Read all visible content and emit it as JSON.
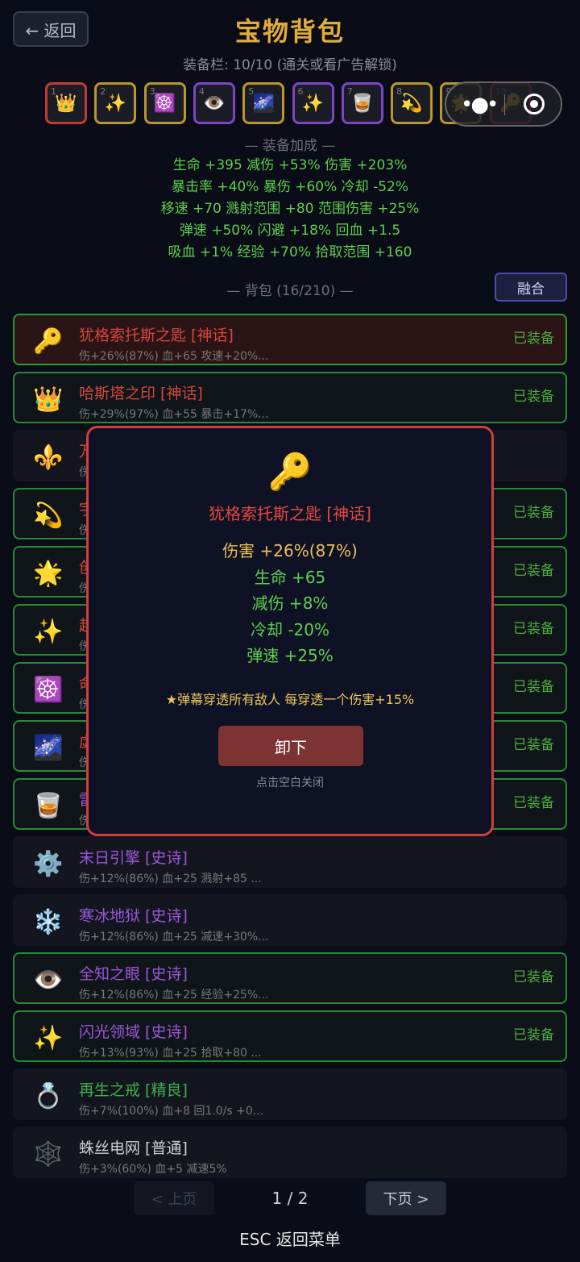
{
  "header": {
    "back_label": "← 返回",
    "title": "宝物背包",
    "slot_info": "装备栏: 10/10 (通关或看广告解锁)"
  },
  "slots": [
    {
      "num": "1",
      "icon": "👑",
      "color": "#c23a35"
    },
    {
      "num": "2",
      "icon": "✨",
      "color": "#b9962e"
    },
    {
      "num": "3",
      "icon": "☸️",
      "color": "#b9962e"
    },
    {
      "num": "4",
      "icon": "👁️",
      "color": "#7d45c4"
    },
    {
      "num": "5",
      "icon": "🌌",
      "color": "#b9962e"
    },
    {
      "num": "6",
      "icon": "✨",
      "color": "#7d45c4"
    },
    {
      "num": "7",
      "icon": "🥃",
      "color": "#7d45c4"
    },
    {
      "num": "8",
      "icon": "💫",
      "color": "#b9962e"
    },
    {
      "num": "9",
      "icon": "🌟",
      "color": "#b9962e"
    },
    {
      "num": "10",
      "icon": "🔑",
      "color": "#c23a35"
    }
  ],
  "bonus": {
    "title": "— 装备加成 —",
    "lines": [
      "生命 +395  减伤 +53%  伤害 +203%",
      "暴击率 +40%  暴伤 +60%  冷却 -52%",
      "移速 +70  溅射范围 +80  范围伤害 +25%",
      "弹速 +50%  闪避 +18%  回血 +1.5",
      "吸血 +1%  经验 +70%  拾取范围 +160"
    ]
  },
  "bag": {
    "title": "— 背包 (16/210) —",
    "fuse_label": "融合"
  },
  "items": [
    {
      "icon": "🔑",
      "name": "犹格索托斯之匙 [神话]",
      "desc": "伤+26%(87%) 血+65 攻速+20%...",
      "equipped": "已装备",
      "rarity": "myth",
      "state": "active"
    },
    {
      "icon": "👑",
      "name": "哈斯塔之印 [神话]",
      "desc": "伤+29%(97%) 血+55 暴击+17%...",
      "equipped": "已装备",
      "rarity": "myth",
      "state": "equipped"
    },
    {
      "icon": "⚜️",
      "name": "万",
      "desc": "伤",
      "equipped": "",
      "rarity": "myth",
      "state": "plain"
    },
    {
      "icon": "💫",
      "name": "宇",
      "desc": "伤",
      "equipped": "已装备",
      "rarity": "myth",
      "state": "equipped"
    },
    {
      "icon": "🌟",
      "name": "创",
      "desc": "伤",
      "equipped": "已装备",
      "rarity": "myth",
      "state": "equipped"
    },
    {
      "icon": "✨",
      "name": "超",
      "desc": "伤",
      "equipped": "已装备",
      "rarity": "myth",
      "state": "equipped"
    },
    {
      "icon": "☸️",
      "name": "命",
      "desc": "伤",
      "equipped": "已装备",
      "rarity": "myth",
      "state": "equipped"
    },
    {
      "icon": "🌌",
      "name": "虚",
      "desc": "伤",
      "equipped": "已装备",
      "rarity": "myth",
      "state": "equipped"
    },
    {
      "icon": "🥃",
      "name": "雷",
      "desc": "伤",
      "equipped": "已装备",
      "rarity": "epic",
      "state": "equipped"
    },
    {
      "icon": "⚙️",
      "name": "末日引擎 [史诗]",
      "desc": "伤+12%(86%) 血+25 溅射+85 ...",
      "equipped": "",
      "rarity": "epic",
      "state": "plain"
    },
    {
      "icon": "❄️",
      "name": "寒冰地狱 [史诗]",
      "desc": "伤+12%(86%) 血+25 减速+30%...",
      "equipped": "",
      "rarity": "epic",
      "state": "plain"
    },
    {
      "icon": "👁️",
      "name": "全知之眼 [史诗]",
      "desc": "伤+12%(86%) 血+25 经验+25%...",
      "equipped": "已装备",
      "rarity": "epic",
      "state": "equipped"
    },
    {
      "icon": "✨",
      "name": "闪光领域 [史诗]",
      "desc": "伤+13%(93%) 血+25 拾取+80 ...",
      "equipped": "已装备",
      "rarity": "epic",
      "state": "equipped"
    },
    {
      "icon": "💍",
      "name": "再生之戒 [精良]",
      "desc": "伤+7%(100%) 血+8 回1.0/s +0...",
      "equipped": "",
      "rarity": "fine",
      "state": "plain"
    },
    {
      "icon": "🕸️",
      "name": "蛛丝电网 [普通]",
      "desc": "伤+3%(60%) 血+5 减速5%",
      "equipped": "",
      "rarity": "common",
      "state": "plain"
    }
  ],
  "pager": {
    "prev": "< 上页",
    "page": "1 / 2",
    "next": "下页 >"
  },
  "footer": {
    "esc": "ESC 返回菜单"
  },
  "modal": {
    "icon": "🔑",
    "name": "犹格索托斯之匙 [神话]",
    "stats": [
      {
        "text": "伤害 +26%(87%)",
        "gold": true
      },
      {
        "text": "生命 +65",
        "gold": false
      },
      {
        "text": "减伤 +8%",
        "gold": false
      },
      {
        "text": "冷却 -20%",
        "gold": false
      },
      {
        "text": "弹速 +25%",
        "gold": false
      }
    ],
    "special": "★弹幕穿透所有敌人 每穿透一个伤害+15%",
    "unequip": "卸下",
    "hint": "点击空白关闭"
  }
}
